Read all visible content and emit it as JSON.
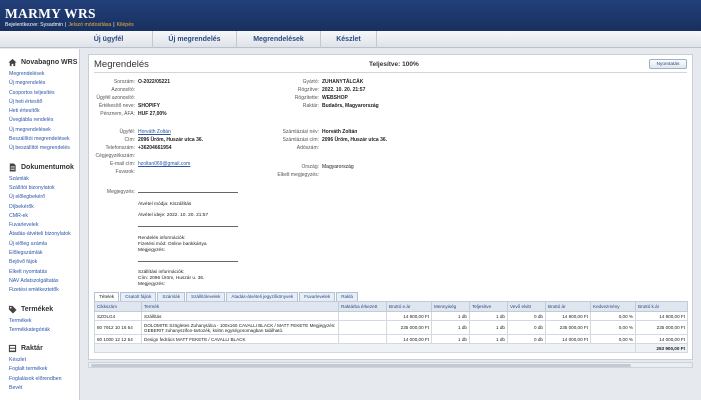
{
  "app": {
    "brand": "MARMY WRS",
    "user_prefix": "Bejelentkezve: Sysadmin",
    "password_link": "Jelszó módosítása",
    "logout_link": "Kilépés",
    "separator": "|"
  },
  "topnav": [
    "Új ügyfél",
    "Új megrendelés",
    "Megrendelések",
    "Készlet"
  ],
  "sidebar": {
    "sections": [
      {
        "title": "Novabagno WRS",
        "icon": "home-icon",
        "items": [
          "Megrendelések",
          "Új megrendelés",
          "Csoportos teljesítés",
          "Új heti értesítő",
          "Heti értesítők",
          "Üveglábla rendelés",
          "Új megrendelések",
          "Beszállítói megrendelések",
          "Új beszállítói megrendelés"
        ]
      },
      {
        "title": "Dokumentumok",
        "icon": "document-icon",
        "items": [
          "Számlák",
          "Szállítói bizonylatok",
          "Új előlegbekérő",
          "Díjbekérők",
          "CMR-ek",
          "Fuvarlevelek",
          "Átadás-átvételi bizonylatok",
          "Új előleg számla",
          "Előlegszámlák",
          "Bejövő fájok",
          "Elkelt nyomtatás",
          "NAV Adatszolgáltatás",
          "Fizetési emlékeztetők"
        ]
      },
      {
        "title": "Termékek",
        "icon": "tag-icon",
        "items": [
          "Termékek",
          "Termékkategóriák"
        ]
      },
      {
        "title": "Raktár",
        "icon": "warehouse-icon",
        "items": [
          "Készlet",
          "Foglalt termékek",
          "Foglalások előrendben",
          "Bevét"
        ]
      }
    ]
  },
  "page": {
    "title": "Megrendelés",
    "status": "Teljesítve: 100%",
    "print_button": "Nyomtatás"
  },
  "order_left": [
    {
      "label": "Sorszám:",
      "value": "O-2022/05221"
    },
    {
      "label": "Azonosító:",
      "value": ""
    },
    {
      "label": "Ügyfél azonosító:",
      "value": ""
    },
    {
      "label": "Értékesítő neve:",
      "value": "SHOPIFY"
    },
    {
      "label": "Pénznem, ÁFA:",
      "value": "HUF 27,00%"
    }
  ],
  "order_right": [
    {
      "label": "Gyártó:",
      "value": "ZUHANYTÁLCÁK"
    },
    {
      "label": "Rögzítve:",
      "value": "2022. 10. 20. 21:57"
    },
    {
      "label": "Rögzítette:",
      "value": "WEBSHOP"
    },
    {
      "label": "Raktár:",
      "value": "Budaörs, Magyarország"
    }
  ],
  "customer_left": [
    {
      "label": "Ügyfél:",
      "value": "Horváth Zoltán"
    },
    {
      "label": "Cím:",
      "value": "2096 Üröm, Huszár utca 36."
    },
    {
      "label": "Telefonszám:",
      "value": "+36204661954"
    },
    {
      "label": "Cégjegyzékszám:",
      "value": ""
    },
    {
      "label": "E-mail cím:",
      "value": "hzoltan069@gmail.com"
    },
    {
      "label": "Fuvarok:",
      "value": ""
    }
  ],
  "customer_right": [
    {
      "label": "Számlázási név:",
      "value": "Horváth Zoltán"
    },
    {
      "label": "Számlázási cím:",
      "value": "2096 Üröm, Huszár utca 36."
    },
    {
      "label": "Adószám:",
      "value": ""
    },
    {
      "label": "Ország:",
      "value": "Magyarország"
    },
    {
      "label": "Elkelt megjegyzés:",
      "value": ""
    }
  ],
  "notes": {
    "megjegyzes_label": "Megjegyzés:",
    "atveteli_mod": "Átvétel módja: Kiszállítás",
    "atvetel_ideje": "Átvétel ideje: 2022. 10. 20. 21:57",
    "rendeles_info": "Rendelés információk:",
    "fizetesi_mod": "Fizetési mód: Online bankkártya",
    "megjegyzes2": "Megjegyzés:",
    "szallitasi_info": "Szállítási információk:",
    "szallitasi_cim": "Cím: 2096 Üröm, Huszár u. 36.",
    "megjegyzes3": "Megjegyzés:"
  },
  "tabs": [
    "Tételek",
    "Csatolt fájlok",
    "Számlák",
    "Szállítólevelek",
    "Átadás-átvételi jegyzőkönyvek",
    "Fuvarlevelek",
    "Raklá"
  ],
  "table": {
    "headers": [
      "Cikkszám",
      "Termék",
      "Raktárba érkezett",
      "Bruttó e.ár",
      "Mennyiség",
      "Teljesítve",
      "Vevő elvitt",
      "Bruttó ár",
      "Kedvezmény",
      "Bruttó k.ár"
    ],
    "rows": [
      {
        "sku": "SZOLG4",
        "product": "Szállítás",
        "arrived": "",
        "unit_price": "14 900,00 Ft",
        "qty": "1 db",
        "fulfilled": "1 db",
        "taken": "0 db",
        "price": "14 900,00 Ft",
        "discount": "0,00 %",
        "total": "14 900,00 Ft"
      },
      {
        "sku": "80 7912 10 16 54",
        "product": "DOLOMITE Szögletes Zuhanytálca - 100x160 CAVALLI BLACK / MATT FEKETE Megjegyzés: GEBERIT zuhanyszifon-tartozék, külön egységcsomagban található.",
        "arrived": "",
        "unit_price": "235 000,00 Ft",
        "qty": "1 db",
        "fulfilled": "1 db",
        "taken": "0 db",
        "price": "235 000,00 Ft",
        "discount": "0,00 %",
        "total": "235 000,00 Ft"
      },
      {
        "sku": "80 1000 12 12 54",
        "product": "Design fedrács MATT FEKETE / CAVALLI BLACK",
        "arrived": "",
        "unit_price": "14 000,00 Ft",
        "qty": "1 db",
        "fulfilled": "1 db",
        "taken": "0 db",
        "price": "14 000,00 Ft",
        "discount": "0,00 %",
        "total": "14 000,00 Ft"
      }
    ],
    "grand_total": "263 900,00 Ft"
  }
}
